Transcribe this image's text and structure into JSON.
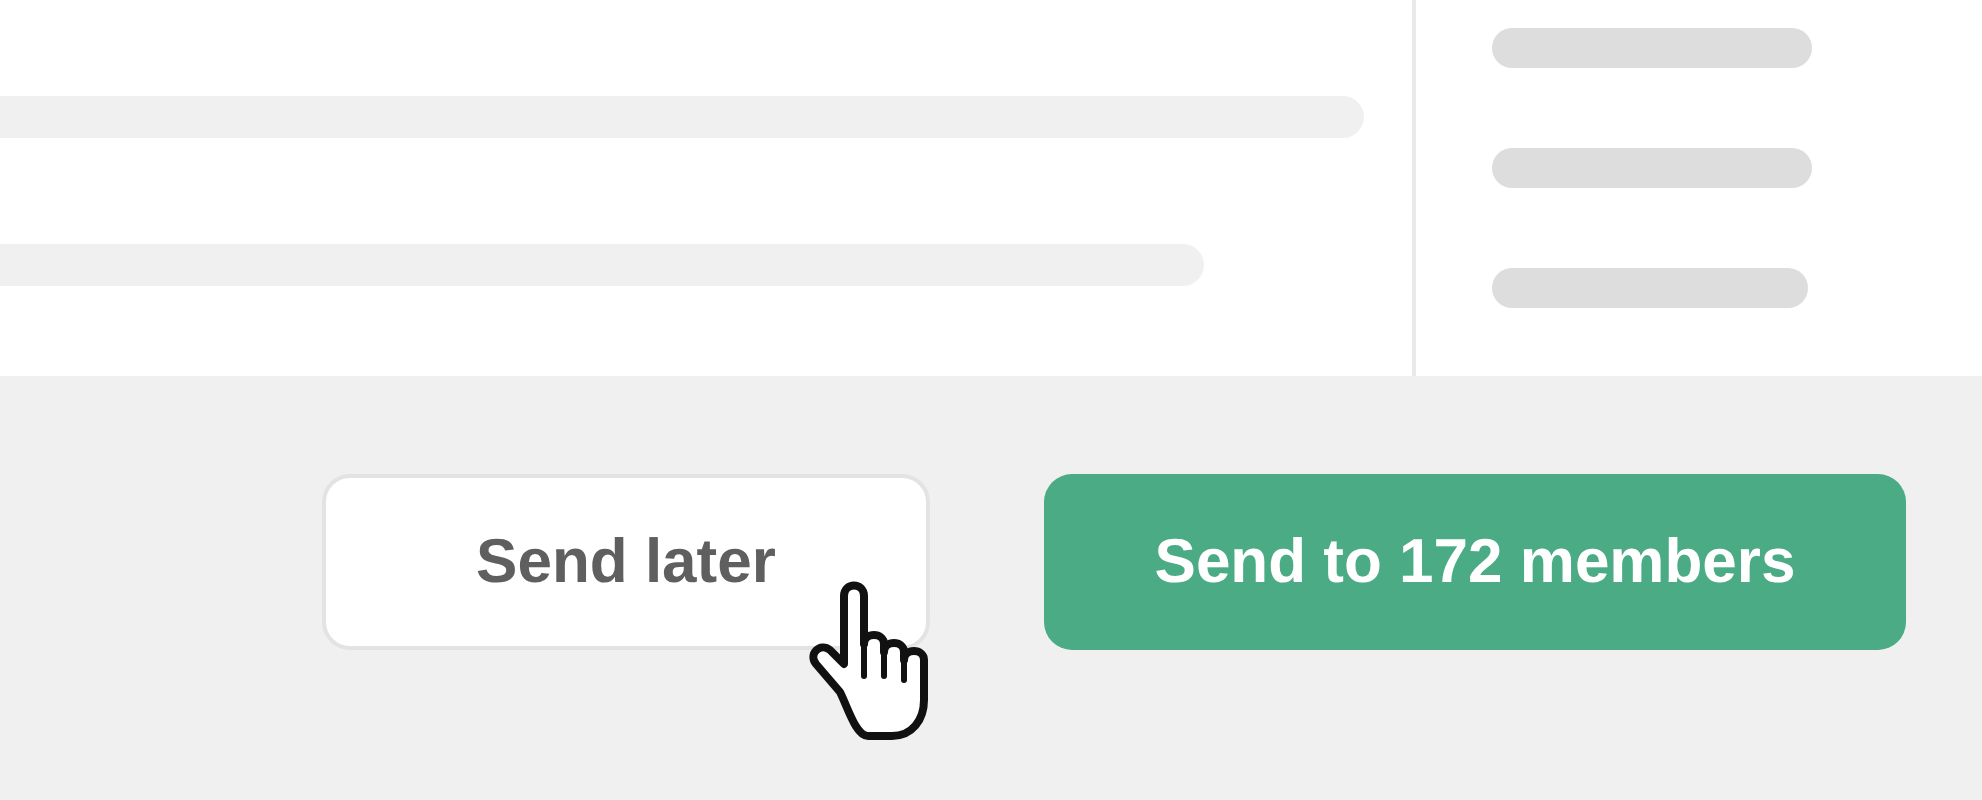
{
  "actions": [
    {
      "label": "Send later",
      "kind": "secondary"
    },
    {
      "label": "Send to 172 members",
      "kind": "primary"
    }
  ]
}
